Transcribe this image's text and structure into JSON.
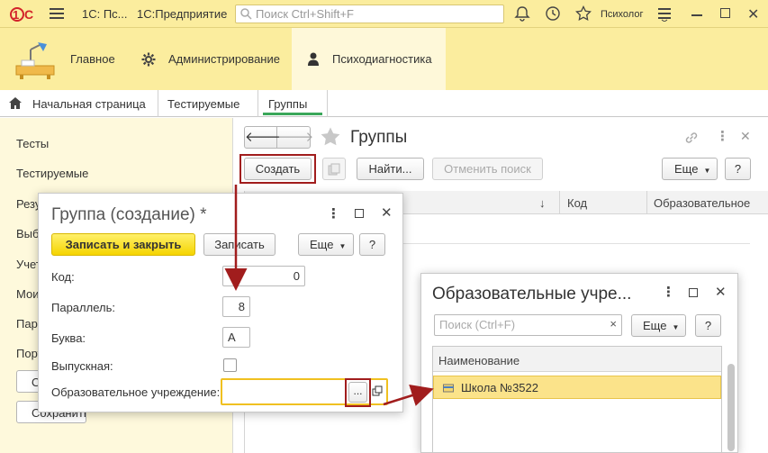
{
  "topbar": {
    "app_name_1": "1С: Пс...",
    "app_name_2": "1С:Предприятие",
    "search_placeholder": "Поиск Ctrl+Shift+F",
    "user": "Психолог"
  },
  "sections": {
    "home": "Главное",
    "admin": "Администрирование",
    "psy": "Психодиагностика"
  },
  "tabs": [
    "Начальная страница",
    "Тестируемые",
    "Группы"
  ],
  "left_nav": {
    "items": [
      "Тесты",
      "Тестируемые",
      "Резу",
      "Выб",
      "Учет",
      "Мои",
      "Пара",
      "Порт"
    ],
    "buttons": [
      "О",
      "Сохранить"
    ]
  },
  "main": {
    "title": "Группы",
    "create": "Создать",
    "find": "Найти...",
    "cancel_search": "Отменить поиск",
    "more": "Еще",
    "help": "?",
    "columns": [
      "↓",
      "Код",
      "Образовательное"
    ]
  },
  "group_dialog": {
    "title": "Группа (создание) *",
    "save_close": "Записать и закрыть",
    "save": "Записать",
    "more": "Еще",
    "help": "?",
    "code_label": "Код:",
    "code_value": "0",
    "parallel_label": "Параллель:",
    "parallel_value": "8",
    "letter_label": "Буква:",
    "letter_value": "А",
    "graduating_label": "Выпускная:",
    "graduating_checked": false,
    "institution_label": "Образовательное учреждение:",
    "institution_value": "",
    "choose_btn": "..."
  },
  "institutions_dialog": {
    "title": "Образовательные учре...",
    "search_placeholder": "Поиск (Ctrl+F)",
    "clear": "×",
    "more": "Еще",
    "help": "?",
    "column": "Наименование",
    "rows": [
      "Школа №3522"
    ]
  },
  "colors": {
    "topbar": "#fbed9e",
    "panel": "#fef9dc",
    "accent_red": "#a11d1d",
    "highlight": "#fbe38a"
  }
}
